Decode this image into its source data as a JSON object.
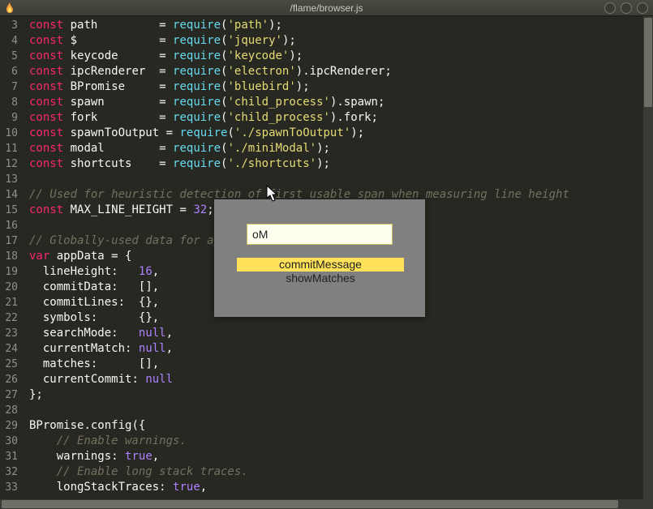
{
  "window": {
    "title": "/flame/browser.js"
  },
  "gutter": {
    "start": 3,
    "end": 33
  },
  "code": {
    "lines": [
      {
        "n": 3,
        "t": "const",
        "id": "path",
        "pad": "         ",
        "rhs": "= require('path');"
      },
      {
        "n": 4,
        "t": "const",
        "id": "$",
        "pad": "            ",
        "rhs": "= require('jquery');"
      },
      {
        "n": 5,
        "t": "const",
        "id": "keycode",
        "pad": "      ",
        "rhs": "= require('keycode');"
      },
      {
        "n": 6,
        "t": "const",
        "id": "ipcRenderer",
        "pad": "  ",
        "rhs": "= require('electron').ipcRenderer;"
      },
      {
        "n": 7,
        "t": "const",
        "id": "BPromise",
        "pad": "     ",
        "rhs": "= require('bluebird');"
      },
      {
        "n": 8,
        "t": "const",
        "id": "spawn",
        "pad": "        ",
        "rhs": "= require('child_process').spawn;"
      },
      {
        "n": 9,
        "t": "const",
        "id": "fork",
        "pad": "         ",
        "rhs": "= require('child_process').fork;"
      },
      {
        "n": 10,
        "t": "const",
        "id": "spawnToOutput",
        "pad": "",
        "rhs": " = require('./spawnToOutput');"
      },
      {
        "n": 11,
        "t": "const",
        "id": "modal",
        "pad": "        ",
        "rhs": "= require('./miniModal');"
      },
      {
        "n": 12,
        "t": "const",
        "id": "shortcuts",
        "pad": "    ",
        "rhs": "= require('./shortcuts');"
      },
      {
        "n": 13,
        "t": "blank"
      },
      {
        "n": 14,
        "t": "comment",
        "text": "// Used for heuristic detection of first usable span when measuring line height"
      },
      {
        "n": 15,
        "t": "const",
        "id": "MAX_LINE_HEIGHT",
        "pad": "",
        "rhs2": " = 32;"
      },
      {
        "n": 16,
        "t": "blank"
      },
      {
        "n": 17,
        "t": "comment",
        "text": "// Globally-used data for app state"
      },
      {
        "n": 18,
        "t": "var",
        "id": "appData",
        "rhs3": " = {"
      },
      {
        "n": 19,
        "t": "prop",
        "key": "lineHeight",
        "pad": "   ",
        "val": "16",
        "vt": "num"
      },
      {
        "n": 20,
        "t": "prop",
        "key": "commitData",
        "pad": "   ",
        "val": "[]",
        "vt": "pn"
      },
      {
        "n": 21,
        "t": "prop",
        "key": "commitLines",
        "pad": "  ",
        "val": "{}",
        "vt": "pn"
      },
      {
        "n": 22,
        "t": "prop",
        "key": "symbols",
        "pad": "      ",
        "val": "{}",
        "vt": "pn"
      },
      {
        "n": 23,
        "t": "prop",
        "key": "searchMode",
        "pad": "   ",
        "val": "null",
        "vt": "nul"
      },
      {
        "n": 24,
        "t": "prop",
        "key": "currentMatch",
        "pad": " ",
        "val": "null",
        "vt": "nul"
      },
      {
        "n": 25,
        "t": "prop",
        "key": "matches",
        "pad": "      ",
        "val": "[]",
        "vt": "pn"
      },
      {
        "n": 26,
        "t": "prop",
        "key": "currentCommit",
        "pad": "",
        "val": "null",
        "vt": "nul",
        "last": true
      },
      {
        "n": 27,
        "t": "raw",
        "text": "};"
      },
      {
        "n": 28,
        "t": "blank"
      },
      {
        "n": 29,
        "t": "call",
        "text": "BPromise.config({"
      },
      {
        "n": 30,
        "t": "comment",
        "text": "    // Enable warnings."
      },
      {
        "n": 31,
        "t": "cfg",
        "key": "warnings",
        "val": "true"
      },
      {
        "n": 32,
        "t": "comment",
        "text": "    // Enable long stack traces."
      },
      {
        "n": 33,
        "t": "cfg",
        "key": "longStackTraces",
        "val": "true"
      }
    ]
  },
  "popup": {
    "input_value": "oM",
    "items": [
      {
        "label": "commitMessage",
        "selected": true
      },
      {
        "label": "showMatches",
        "selected": false
      }
    ]
  }
}
